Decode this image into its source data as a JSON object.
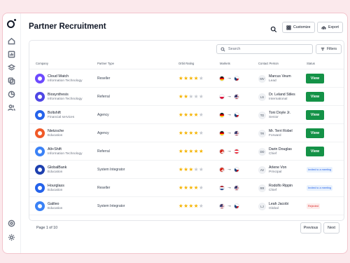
{
  "header": {
    "title": "Partner Recruitment",
    "customize_label": "Customize",
    "export_label": "Export"
  },
  "sidebar": {
    "items": [
      {
        "icon": "home-icon"
      },
      {
        "icon": "chart-icon"
      },
      {
        "icon": "layers-icon"
      },
      {
        "icon": "copy-icon"
      },
      {
        "icon": "pie-chart-icon"
      },
      {
        "icon": "users-icon"
      }
    ],
    "bottom": [
      {
        "icon": "settings-icon"
      },
      {
        "icon": "gear-icon"
      }
    ]
  },
  "toolbar": {
    "search_placeholder": "Search",
    "filters_label": "Filters"
  },
  "table": {
    "columns": [
      "Company",
      "Partner Type",
      "Orbit Rating",
      "Markets",
      "Contact Person",
      "Status"
    ],
    "rows": [
      {
        "company": "Cloud Watch",
        "industry": "Information Technology",
        "partner_type": "Reseller",
        "rating": 4,
        "markets": [
          "Germany",
          "Czech Republic"
        ],
        "initials": "MV",
        "contact": "Marcus Veum",
        "role": "Lead",
        "status": "View",
        "logo_color": "#6d4aff"
      },
      {
        "company": "Biosynthesis",
        "industry": "Information Technology",
        "partner_type": "Referral",
        "rating": 2,
        "markets": [
          "Poland",
          "United States"
        ],
        "initials": "LS",
        "contact": "Dr. Leland Stiles",
        "role": "International",
        "status": "View",
        "logo_color": "#4f46e5"
      },
      {
        "company": "Boltshift",
        "industry": "Financial services",
        "partner_type": "Agency",
        "rating": 4,
        "markets": [
          "Germany",
          "Czech Republic"
        ],
        "initials": "TD",
        "contact": "Toni Doyle Jr.",
        "role": "Senior",
        "status": "View",
        "logo_color": "#2563eb"
      },
      {
        "company": "Nietzsche",
        "industry": "Education",
        "partner_type": "Agency",
        "rating": 4,
        "markets": [
          "Germany",
          "United States"
        ],
        "initials": "TR",
        "contact": "Mr. Terri Robel",
        "role": "Forward",
        "status": "View",
        "logo_color": "#f05a28"
      },
      {
        "company": "Alt+Shift",
        "industry": "Information Technology",
        "partner_type": "Referral",
        "rating": 5,
        "markets": [
          "Switzerland",
          "Austria"
        ],
        "initials": "DD",
        "contact": "Darin Douglas",
        "role": "Chief",
        "status": "View",
        "logo_color": "#3b82f6"
      },
      {
        "company": "GlobalBank",
        "industry": "Education",
        "partner_type": "System Integrator",
        "rating": 3,
        "markets": [
          "Switzerland",
          "Czech Republic"
        ],
        "initials": "AV",
        "contact": "Arlene Von",
        "role": "Principal",
        "status": "Invited to a meeting",
        "logo_color": "#1e40af"
      },
      {
        "company": "Hourglass",
        "industry": "Education",
        "partner_type": "Reseller",
        "rating": 4,
        "markets": [
          "Netherlands",
          "United States"
        ],
        "initials": "RR",
        "contact": "Rodolfo Rippin",
        "role": "Chief",
        "status": "Invited to a meeting",
        "logo_color": "#2563eb"
      },
      {
        "company": "Galileo",
        "industry": "Education",
        "partner_type": "System Integrator",
        "rating": 4,
        "markets": [
          "United States",
          "Czech Republic"
        ],
        "initials": "LJ",
        "contact": "Leah Jacobi",
        "role": "Global",
        "status": "Rejected",
        "logo_color": "#3b82f6"
      }
    ]
  },
  "pagination": {
    "label": "Page 1 of 10",
    "previous_label": "Previous",
    "next_label": "Next"
  },
  "colors": {
    "accent": "#149247",
    "star": "#f5b301"
  }
}
